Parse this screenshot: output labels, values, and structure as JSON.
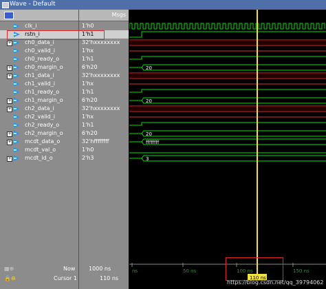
{
  "window": {
    "title": "Wave - Default"
  },
  "header": {
    "msgs_label": "Msgs"
  },
  "signals": [
    {
      "name": "clk_i",
      "value": "1'h0",
      "expandable": false
    },
    {
      "name": "rstn_i",
      "value": "1'h1",
      "expandable": false
    },
    {
      "name": "ch0_data_i",
      "value": "32'hxxxxxxxx",
      "expandable": true
    },
    {
      "name": "ch0_valid_i",
      "value": "1'hx",
      "expandable": false
    },
    {
      "name": "ch0_ready_o",
      "value": "1'h1",
      "expandable": false
    },
    {
      "name": "ch0_margin_o",
      "value": "6'h20",
      "expandable": true
    },
    {
      "name": "ch1_data_i",
      "value": "32'hxxxxxxxx",
      "expandable": true
    },
    {
      "name": "ch1_valid_i",
      "value": "1'hx",
      "expandable": false
    },
    {
      "name": "ch1_ready_o",
      "value": "1'h1",
      "expandable": false
    },
    {
      "name": "ch1_margin_o",
      "value": "6'h20",
      "expandable": true
    },
    {
      "name": "ch2_data_i",
      "value": "32'hxxxxxxxx",
      "expandable": true
    },
    {
      "name": "ch2_valid_i",
      "value": "1'hx",
      "expandable": false
    },
    {
      "name": "ch2_ready_o",
      "value": "1'h1",
      "expandable": false
    },
    {
      "name": "ch2_margin_o",
      "value": "6'h20",
      "expandable": true
    },
    {
      "name": "mcdt_data_o",
      "value": "32'hffffffff",
      "expandable": true
    },
    {
      "name": "mcdt_val_o",
      "value": "1'h0",
      "expandable": false
    },
    {
      "name": "mcdt_id_o",
      "value": "2'h3",
      "expandable": true
    }
  ],
  "wave_labels": {
    "ch0_margin": "20",
    "ch1_margin": "20",
    "ch2_margin": "20",
    "mcdt_data": "ffffffff",
    "mcdt_id": "3"
  },
  "timeline": {
    "ticks": [
      "ns",
      "50 ns",
      "100 ns",
      "150 ns"
    ],
    "cursor_time": "110 ns"
  },
  "status": {
    "now_label": "Now",
    "now_value": "1000 ns",
    "cursor_label": "Cursor 1",
    "cursor_value": "110 ns"
  },
  "watermark": "https://blog.csdn.net/qq_39794062",
  "colors": {
    "clock": "#00e000",
    "high": "#00e000",
    "zero": "#e03030",
    "unknown": "#e03030",
    "cursor": "#f0e040",
    "redbox": "#e0282c"
  }
}
